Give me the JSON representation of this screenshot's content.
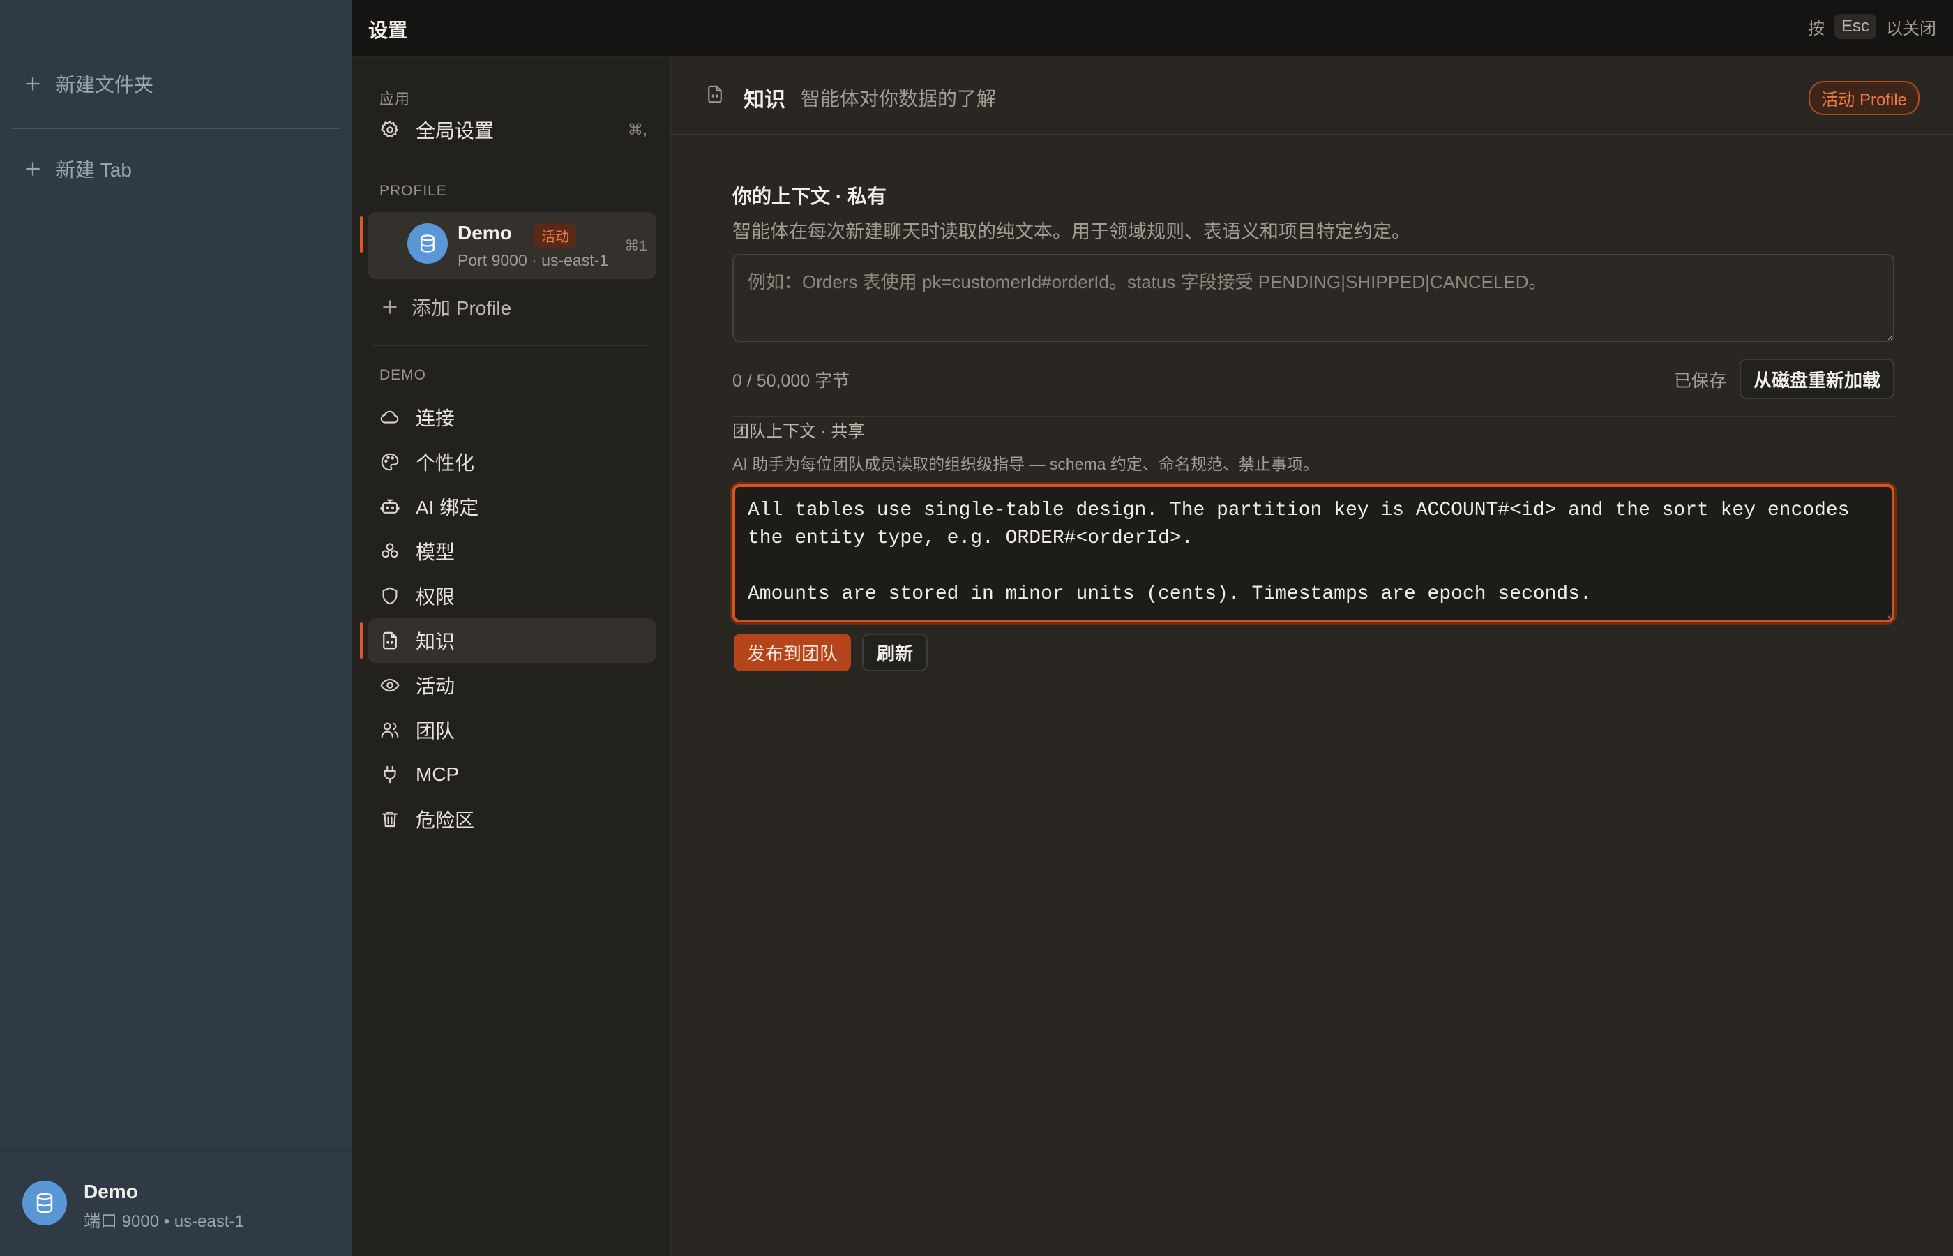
{
  "rail": {
    "new_folder": "新建文件夹",
    "new_tab": "新建 Tab",
    "footer": {
      "name": "Demo",
      "sub": "端口 9000 • us-east-1"
    }
  },
  "topbar": {
    "title": "设置",
    "hint_press": "按",
    "hint_key": "Esc",
    "hint_close": "以关闭"
  },
  "nav": {
    "section_app": "应用",
    "global_settings": {
      "label": "全局设置",
      "shortcut": "⌘,"
    },
    "section_profile": "PROFILE",
    "profile": {
      "name": "Demo",
      "badge": "活动",
      "sub": "Port 9000 · us-east-1",
      "shortcut": "⌘1"
    },
    "add_profile": "添加 Profile",
    "section_demo": "DEMO",
    "items": [
      {
        "label": "连接",
        "icon": "cloud-icon"
      },
      {
        "label": "个性化",
        "icon": "palette-icon"
      },
      {
        "label": "AI 绑定",
        "icon": "robot-icon"
      },
      {
        "label": "模型",
        "icon": "model-icon"
      },
      {
        "label": "权限",
        "icon": "shield-icon"
      },
      {
        "label": "知识",
        "icon": "file-code-icon",
        "active": true
      },
      {
        "label": "活动",
        "icon": "eye-icon"
      },
      {
        "label": "团队",
        "icon": "users-icon"
      },
      {
        "label": "MCP",
        "icon": "plug-icon"
      },
      {
        "label": "危险区",
        "icon": "trash-icon"
      }
    ]
  },
  "main": {
    "title": "知识",
    "subtitle": "智能体对你数据的了解",
    "badge": "活动 Profile",
    "private": {
      "title": "你的上下文 · 私有",
      "desc": "智能体在每次新建聊天时读取的纯文本。用于领域规则、表语义和项目特定约定。",
      "placeholder": "例如：Orders 表使用 pk=customerId#orderId。status 字段接受 PENDING|SHIPPED|CANCELED。",
      "value": "",
      "bytes": "0 / 50,000 字节",
      "saved": "已保存",
      "reload": "从磁盘重新加载"
    },
    "team": {
      "title": "团队上下文 · 共享",
      "desc": "AI 助手为每位团队成员读取的组织级指导 — schema 约定、命名规范、禁止事项。",
      "value": "All tables use single-table design. The partition key is ACCOUNT#<id> and the sort key encodes the entity type, e.g. ORDER#<orderId>.\n\nAmounts are stored in minor units (cents). Timestamps are epoch seconds.",
      "publish": "发布到团队",
      "refresh": "刷新"
    }
  },
  "colors": {
    "accent": "#d4541f",
    "avatar": "#5a97d6"
  }
}
